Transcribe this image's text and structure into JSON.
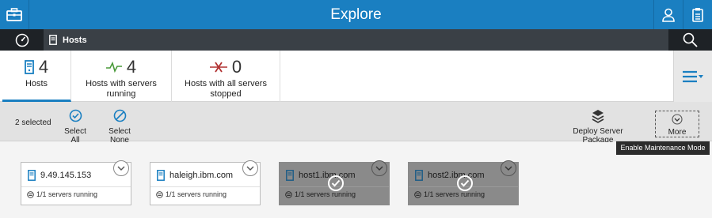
{
  "header": {
    "title": "Explore",
    "app_icon": "toolbox-icon",
    "user_icon": "user-icon",
    "clipboard_icon": "clipboard-icon"
  },
  "nav": {
    "dashboard_icon": "dashboard-gauge-icon",
    "breadcrumb_label": "Hosts",
    "search_icon": "search-icon"
  },
  "stats": [
    {
      "count": "4",
      "label": "Hosts",
      "icon": "server-icon"
    },
    {
      "count": "4",
      "label": "Hosts with servers running",
      "icon": "pulse-icon"
    },
    {
      "count": "0",
      "label": "Hosts with all servers stopped",
      "icon": "stopped-icon"
    }
  ],
  "toolbar": {
    "selected_text": "2 selected",
    "select_all": "Select All",
    "select_none": "Select None",
    "deploy": "Deploy Server Package",
    "more": "More"
  },
  "tooltip": "Enable Maintenance Mode",
  "hosts": [
    {
      "name": "9.49.145.153",
      "status": "1/1 servers running",
      "selected": false
    },
    {
      "name": "haleigh.ibm.com",
      "status": "1/1 servers running",
      "selected": false
    },
    {
      "name": "host1.ibm.com",
      "status": "1/1 servers running",
      "selected": true
    },
    {
      "name": "host2.ibm.com",
      "status": "1/1 servers running",
      "selected": true
    }
  ],
  "colors": {
    "accent": "#1a7fc1",
    "running": "#4a9a3a",
    "stopped": "#b03030",
    "navbar": "#3a4046"
  }
}
